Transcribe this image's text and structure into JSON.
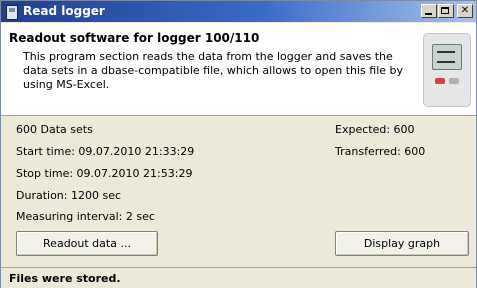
{
  "window": {
    "title": "Read logger",
    "title_icon": "logger-device-icon",
    "minimize_icon": "minimize-icon",
    "maximize_icon": "maximize-icon",
    "close_icon": "close-icon",
    "close_glyph": "✕"
  },
  "header": {
    "title": "Readout software for logger 100/110",
    "description": "This program section reads the data from the logger and saves the data sets in a dbase-compatible file, which allows to open this file by using MS-Excel.",
    "image_icon": "data-logger-device-image"
  },
  "info": {
    "data_sets": "600 Data sets",
    "start_time": "Start time: 09.07.2010 21:33:29",
    "stop_time": "Stop time: 09.07.2010 21:53:29",
    "duration": "Duration: 1200 sec",
    "interval": "Measuring interval: 2 sec",
    "expected": "Expected: 600",
    "transferred": "Transferred: 600"
  },
  "buttons": {
    "readout": "Readout data ...",
    "display": "Display graph"
  },
  "status": {
    "text": "Files were stored."
  }
}
